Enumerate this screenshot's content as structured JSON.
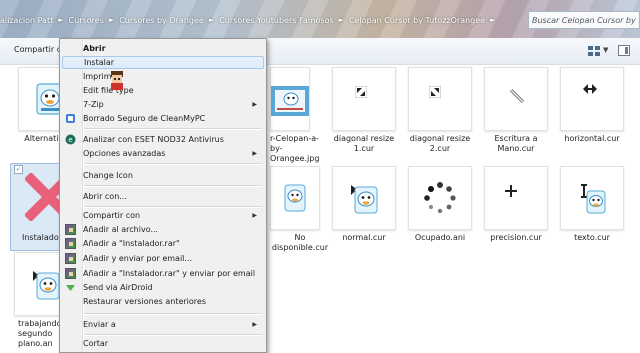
{
  "address_bar": {
    "crumbs": [
      "alizacion Patt",
      "Cursores",
      "Cursores by Orangee",
      "Cursores Youtubers Famosos",
      "Celopan Cursor by TutozzOrangee"
    ],
    "search_placeholder": "Buscar Celopan Cursor by ..."
  },
  "toolbar": {
    "share_label": "Compartir co"
  },
  "files": [
    {
      "name": "Alternative...",
      "kind": "cursor-duck"
    },
    {
      "name": "r-Celopan-a-by-Orangee.jpg",
      "kind": "image"
    },
    {
      "name": "diagonal resize 1.cur",
      "kind": "cursor-diag1"
    },
    {
      "name": "diagonal resize 2.cur",
      "kind": "cursor-diag2"
    },
    {
      "name": "Escritura a Mano.cur",
      "kind": "cursor-pen"
    },
    {
      "name": "horizontal.cur",
      "kind": "cursor-horizontal"
    },
    {
      "name": "Instalador...",
      "kind": "installer",
      "selected": true
    },
    {
      "name": "No disponible.cur",
      "kind": "cursor-duck"
    },
    {
      "name": "normal.cur",
      "kind": "cursor-duck-arrow"
    },
    {
      "name": "Ocupado.ani",
      "kind": "cursor-busy"
    },
    {
      "name": "precision.cur",
      "kind": "cursor-cross"
    },
    {
      "name": "texto.cur",
      "kind": "cursor-text"
    },
    {
      "name": "trabajando segundo plano.an",
      "kind": "cursor-duck-arrow"
    }
  ],
  "context_menu": {
    "items": [
      {
        "label": "Abrir",
        "bold": true
      },
      {
        "label": "Instalar",
        "hover": true
      },
      {
        "label": "Imprimir"
      },
      {
        "label": "Edit file type"
      },
      {
        "label": "7-Zip",
        "submenu": true
      },
      {
        "label": "Borrado Seguro de CleanMyPC",
        "icon": "cleanmypc-icon"
      },
      {
        "separator": true
      },
      {
        "label": "Analizar con ESET NOD32 Antivirus",
        "icon": "eset-icon"
      },
      {
        "label": "Opciones avanzadas",
        "submenu": true
      },
      {
        "separator": true
      },
      {
        "label": "Change Icon"
      },
      {
        "separator": true
      },
      {
        "label": "Abrir con..."
      },
      {
        "separator": true
      },
      {
        "label": "Compartir con",
        "submenu": true
      },
      {
        "label": "Añadir al archivo...",
        "icon": "winrar-icon"
      },
      {
        "label": "Añadir a \"Instalador.rar\"",
        "icon": "winrar-icon"
      },
      {
        "label": "Añadir y enviar por email...",
        "icon": "winrar-icon"
      },
      {
        "label": "Añadir a \"Instalador.rar\" y enviar por email",
        "icon": "winrar-icon"
      },
      {
        "label": "Send via AirDroid",
        "icon": "airdroid-icon"
      },
      {
        "label": "Restaurar versiones anteriores"
      },
      {
        "separator": true
      },
      {
        "label": "Enviar a",
        "submenu": true
      },
      {
        "separator": true
      },
      {
        "label": "Cortar"
      }
    ]
  },
  "colors": {
    "selection": "#dbe8f6",
    "menu_bg": "#f0f0f0",
    "hover_border": "#a8c8ec",
    "installer_x": "#e8607a"
  }
}
